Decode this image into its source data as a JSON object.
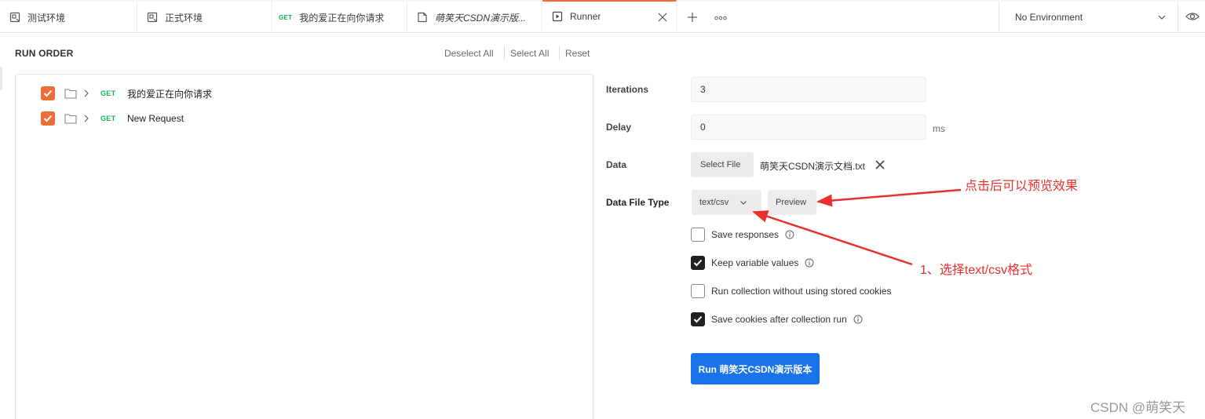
{
  "tabs": [
    {
      "label": "测试环境",
      "icon": "environment-icon"
    },
    {
      "label": "正式环境",
      "icon": "environment-icon"
    },
    {
      "method": "GET",
      "label": "我的爱正在向你请求"
    },
    {
      "label": "萌笑天CSDN演示版...",
      "icon": "collection-icon"
    },
    {
      "label": "Runner",
      "icon": "runner-icon",
      "active": true
    }
  ],
  "environment": {
    "label": "No Environment"
  },
  "run_order": {
    "title": "RUN ORDER",
    "deselect_all": "Deselect All",
    "select_all": "Select All",
    "reset": "Reset",
    "items": [
      {
        "method": "GET",
        "name": "我的爱正在向你请求",
        "checked": true
      },
      {
        "method": "GET",
        "name": "New Request",
        "checked": true
      }
    ]
  },
  "form": {
    "iterations_label": "Iterations",
    "iterations_value": "3",
    "delay_label": "Delay",
    "delay_value": "0",
    "delay_unit": "ms",
    "data_label": "Data",
    "select_file_label": "Select File",
    "file_name": "萌笑天CSDN演示文档.txt",
    "data_file_type_label": "Data File Type",
    "data_file_type_value": "text/csv",
    "preview_label": "Preview",
    "options": [
      {
        "label": "Save responses",
        "checked": false,
        "info": true
      },
      {
        "label": "Keep variable values",
        "checked": true,
        "info": true
      },
      {
        "label": "Run collection without using stored cookies",
        "checked": false,
        "info": false
      },
      {
        "label": "Save cookies after collection run",
        "checked": true,
        "info": true
      }
    ],
    "run_button_label": "Run 萌笑天CSDN演示版本"
  },
  "annotations": {
    "preview_note": "点击后可以预览效果",
    "type_note": "1、选择text/csv格式"
  },
  "watermark": "CSDN @萌笑天",
  "colors": {
    "accent": "#f26b3a",
    "method_get": "#0cbb52",
    "run_button": "#1a73e8",
    "annotation": "#e8302e"
  }
}
